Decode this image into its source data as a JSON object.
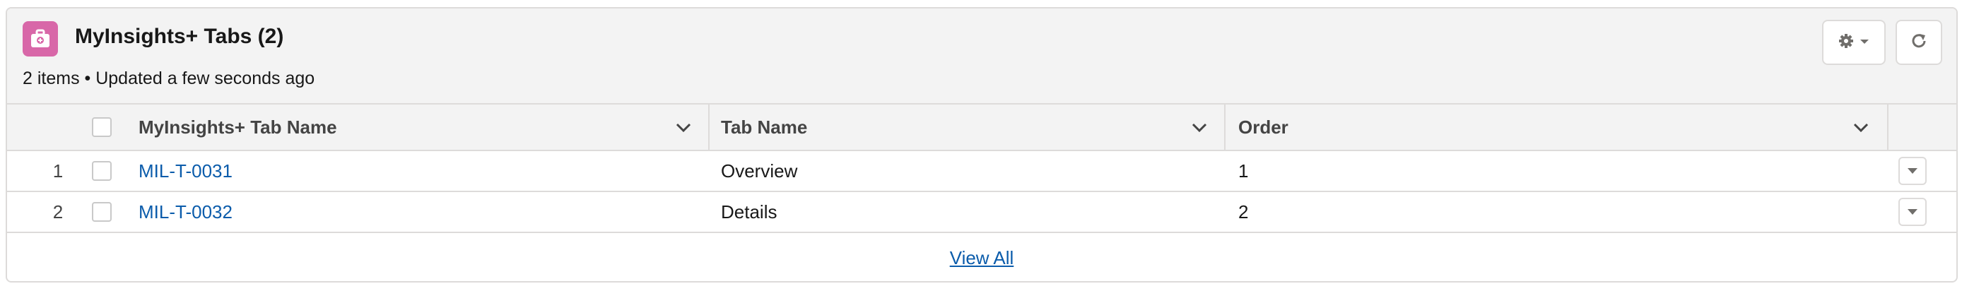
{
  "card": {
    "title": "MyInsights+ Tabs (2)",
    "meta": "2 items • Updated a few seconds ago",
    "icon": "briefcase-icon",
    "icon_color": "#d867a8"
  },
  "toolbar": {
    "settings_icon": "gear-icon",
    "refresh_icon": "refresh-icon"
  },
  "table": {
    "columns": [
      {
        "label": "MyInsights+ Tab Name"
      },
      {
        "label": "Tab Name"
      },
      {
        "label": "Order"
      }
    ],
    "rows": [
      {
        "num": "1",
        "name": "MIL-T-0031",
        "tab_name": "Overview",
        "order": "1"
      },
      {
        "num": "2",
        "name": "MIL-T-0032",
        "tab_name": "Details",
        "order": "2"
      }
    ]
  },
  "footer": {
    "view_all": "View All"
  },
  "colors": {
    "link": "#0b5cab",
    "header_bg": "#f3f3f3",
    "border": "#dddbda"
  }
}
